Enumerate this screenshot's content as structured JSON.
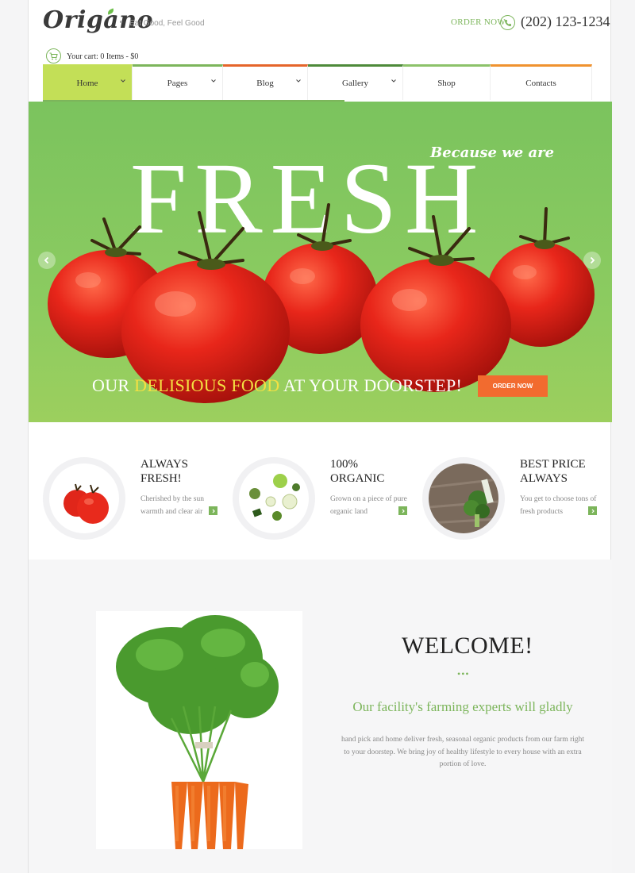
{
  "header": {
    "logo": "Origano",
    "tagline": "Eat Good, Feel Good",
    "order_now": "ORDER NOW",
    "phone": "(202) 123-1234",
    "cart": "Your cart: 0 Items - $0"
  },
  "nav": {
    "items": [
      {
        "label": "Home",
        "has_caret": true
      },
      {
        "label": "Pages",
        "has_caret": true
      },
      {
        "label": "Blog",
        "has_caret": true
      },
      {
        "label": "Gallery",
        "has_caret": true
      },
      {
        "label": "Shop",
        "has_caret": false
      },
      {
        "label": "Contacts",
        "has_caret": false
      }
    ]
  },
  "hero": {
    "script_text": "Because we are",
    "headline": "FRESH",
    "tagline_part1": "OUR ",
    "tagline_highlight": "DELISIOUS FOOD",
    "tagline_part2": " AT YOUR DOORSTEP!",
    "order_button": "ORDER NOW"
  },
  "features": [
    {
      "title_line1": "ALWAYS",
      "title_line2": "FRESH!",
      "desc": "Cherished by the sun warmth and clear air",
      "icon": "tomato-icon"
    },
    {
      "title_line1": "100%",
      "title_line2": "ORGANIC",
      "desc": "Grown on a piece of pure organic land",
      "icon": "vegetables-icon"
    },
    {
      "title_line1": "BEST PRICE",
      "title_line2": "ALWAYS",
      "desc": "You get to choose tons of fresh products",
      "icon": "broccoli-icon"
    }
  ],
  "welcome": {
    "title": "WELCOME!",
    "dots": "•••",
    "subtitle": "Our facility's farming experts will gladly",
    "body": "hand pick and home deliver fresh, seasonal organic products from our farm right to your doorstep. We bring joy of healthy lifestyle to every house with an extra portion of love."
  },
  "colors": {
    "accent_green": "#7cb55b",
    "nav_active": "#c3df57",
    "orange": "#f26b2f",
    "highlight_yellow": "#f4e042"
  }
}
